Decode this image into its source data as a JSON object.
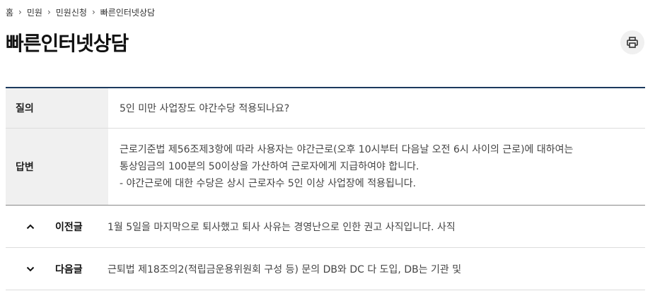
{
  "breadcrumb": [
    "홈",
    "민원",
    "민원신청",
    "빠른인터넷상담"
  ],
  "page_title": "빠른인터넷상담",
  "print_button": {
    "icon": "print-icon",
    "label": "인쇄"
  },
  "qa": {
    "question_label": "질의",
    "question": "5인 미만 사업장도 야간수당 적용되나요?",
    "answer_label": "답변",
    "answer_lines": [
      "근로기준법 제56조제3항에 따라 사용자는 야간근로(오후 10시부터 다음날 오전 6시 사이의 근로)에 대하여는",
      "통상임금의 100분의 50이상을 가산하여 근로자에게 지급하여야 합니다.",
      "- 야간근로에 대한 수당은 상시 근로자수 5인 이상 사업장에 적용됩니다."
    ]
  },
  "nav": {
    "prev": {
      "icon": "chevron-up-icon",
      "label": "이전글",
      "title": "1월 5일을 마지막으로 퇴사했고 퇴사 사유는 경영난으로 인한 권고 사직입니다. 사직"
    },
    "next": {
      "icon": "chevron-down-icon",
      "label": "다음글",
      "title": "근퇴법 제18조의2(적립금운용위원회 구성 등) 문의 DB와 DC 다 도입, DB는 기관 및"
    }
  },
  "colors": {
    "table_top_border": "#1c3a5e",
    "header_bg": "#f0f0f0"
  }
}
